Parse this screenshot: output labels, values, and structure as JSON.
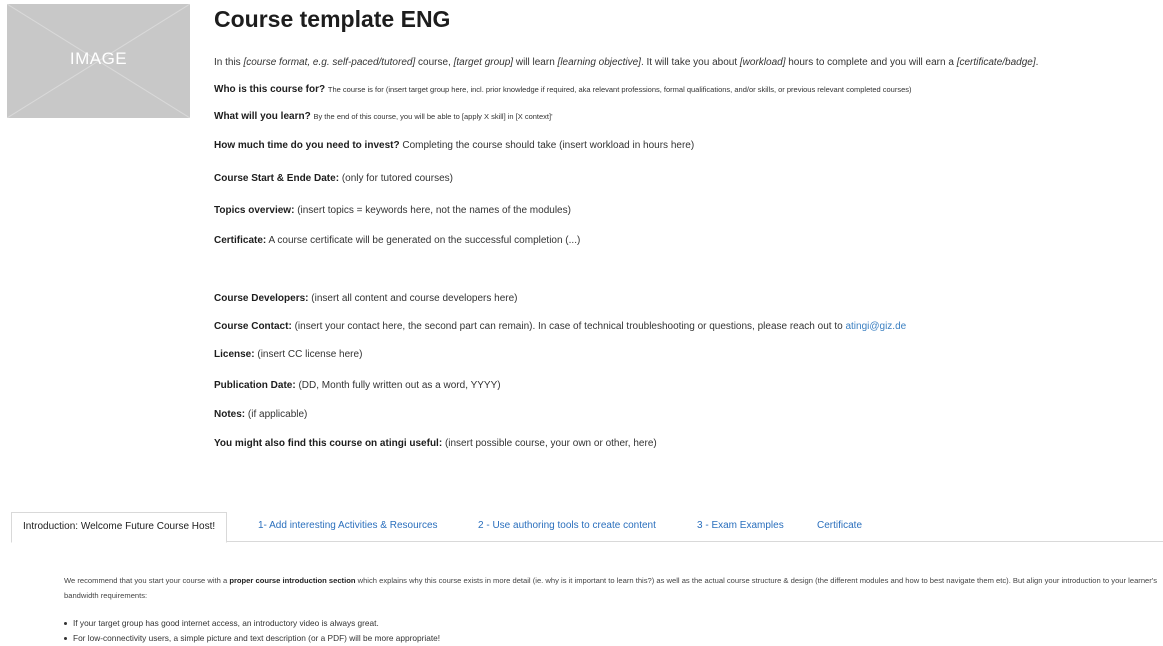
{
  "header": {
    "image_label": "IMAGE",
    "title": "Course template ENG"
  },
  "intro_line": {
    "p1": "In this ",
    "format": "[course format, e.g. self-paced/tutored]",
    "p2": " course, ",
    "group": "[target group]",
    "p3": " will learn ",
    "objective": "[learning objective]",
    "p4": ". It will take you about ",
    "workload": "[workload]",
    "p5": " hours to complete and you will earn a ",
    "certificate": "[certificate/badge]",
    "p6": "."
  },
  "fields": [
    {
      "label": "Who is this course for?",
      "text": "The course is for (insert target group here, incl. prior knowledge if required, aka relevant professions, formal qualifications, and/or skills, or previous relevant completed courses)"
    },
    {
      "label": "What will you learn?",
      "text": "By the end of this course, you will be able to [apply X skill] in  [X context]'"
    },
    {
      "label": "How much time do you need to invest?",
      "text": "Completing the course should take (insert workload in hours here)"
    },
    {
      "label": "Course Start & Ende Date:",
      "text": "(only for tutored courses)"
    },
    {
      "label": "Topics overview:",
      "text": "(insert topics = keywords here, not the names of the modules)"
    },
    {
      "label": "Certificate:",
      "text": "A course certificate will be generated on the successful completion (...)"
    },
    {
      "label": "Course Developers:",
      "text": "(insert all content and course developers here)"
    },
    {
      "label": "Course Contact:",
      "text": "(insert your contact here, the second part can remain). In case of technical troubleshooting or questions, please reach out to ",
      "link": "atingi@giz.de"
    },
    {
      "label": "License:",
      "text": "(insert CC license here)"
    },
    {
      "label": "Publication Date:",
      "text": "(DD, Month fully written out as a word, YYYY)"
    },
    {
      "label": "Notes:",
      "text": "(if applicable)"
    },
    {
      "label": "You might also find this course on atingi useful:",
      "text": "(insert possible course, your own or other, here)"
    }
  ],
  "tabs": [
    {
      "label": "Introduction: Welcome Future Course Host!",
      "active": true
    },
    {
      "label": "1- Add interesting Activities & Resources"
    },
    {
      "label": "2 - Use authoring tools to create content"
    },
    {
      "label": "3 - Exam Examples"
    },
    {
      "label": "Certificate"
    }
  ],
  "tab_content": {
    "intro_pre": "We recommend that you start your course with a ",
    "intro_bold": "proper course introduction section",
    "intro_post": " which explains why this course exists in more detail (ie. why is it important to learn this?) as well as the actual course structure & design (the different modules and how to best navigate them etc). But align your introduction to your learner's bandwidth requirements:",
    "bullets": [
      "If your target group has good internet access, an introductory video is always great.",
      "For low-connectivity users, a simple picture and text description (or a PDF) will be more appropriate!"
    ]
  },
  "colors": {
    "link": "#3a7fc1",
    "placeholder_bg": "#c8c8c8"
  }
}
